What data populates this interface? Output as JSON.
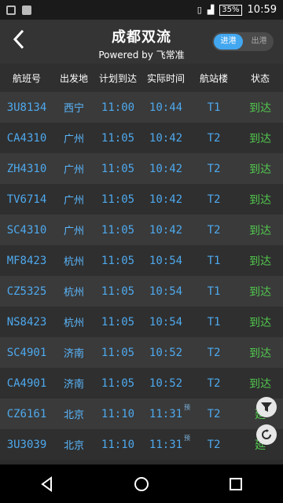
{
  "status_bar": {
    "battery": "35%",
    "time": "10:59",
    "signal_icon": "signal-icon",
    "wifi_icon": "wifi-icon",
    "vibrate_icon": "vibrate-icon"
  },
  "appbar": {
    "title": "成都双流",
    "subtitle": "Powered by 飞常准",
    "tabs": [
      {
        "label": "进港",
        "active": true
      },
      {
        "label": "出港",
        "active": false
      }
    ]
  },
  "table": {
    "headers": [
      "航班号",
      "出发地",
      "计划到达",
      "实际时间",
      "航站楼",
      "状态"
    ],
    "rows": [
      {
        "flight": "3U8134",
        "origin": "西宁",
        "scheduled": "11:00",
        "actual": "10:44",
        "terminal": "T1",
        "status": "到达",
        "mark": ""
      },
      {
        "flight": "CA4310",
        "origin": "广州",
        "scheduled": "11:05",
        "actual": "10:42",
        "terminal": "T2",
        "status": "到达",
        "mark": ""
      },
      {
        "flight": "ZH4310",
        "origin": "广州",
        "scheduled": "11:05",
        "actual": "10:42",
        "terminal": "T2",
        "status": "到达",
        "mark": ""
      },
      {
        "flight": "TV6714",
        "origin": "广州",
        "scheduled": "11:05",
        "actual": "10:42",
        "terminal": "T2",
        "status": "到达",
        "mark": ""
      },
      {
        "flight": "SC4310",
        "origin": "广州",
        "scheduled": "11:05",
        "actual": "10:42",
        "terminal": "T2",
        "status": "到达",
        "mark": ""
      },
      {
        "flight": "MF8423",
        "origin": "杭州",
        "scheduled": "11:05",
        "actual": "10:54",
        "terminal": "T1",
        "status": "到达",
        "mark": ""
      },
      {
        "flight": "CZ5325",
        "origin": "杭州",
        "scheduled": "11:05",
        "actual": "10:54",
        "terminal": "T1",
        "status": "到达",
        "mark": ""
      },
      {
        "flight": "NS8423",
        "origin": "杭州",
        "scheduled": "11:05",
        "actual": "10:54",
        "terminal": "T1",
        "status": "到达",
        "mark": ""
      },
      {
        "flight": "SC4901",
        "origin": "济南",
        "scheduled": "11:05",
        "actual": "10:52",
        "terminal": "T2",
        "status": "到达",
        "mark": ""
      },
      {
        "flight": "CA4901",
        "origin": "济南",
        "scheduled": "11:05",
        "actual": "10:52",
        "terminal": "T2",
        "status": "到达",
        "mark": ""
      },
      {
        "flight": "CZ6161",
        "origin": "北京",
        "scheduled": "11:10",
        "actual": "11:31",
        "terminal": "T2",
        "status": "延",
        "mark": "预"
      },
      {
        "flight": "3U3039",
        "origin": "北京",
        "scheduled": "11:10",
        "actual": "11:31",
        "terminal": "T2",
        "status": "延",
        "mark": "预"
      }
    ]
  },
  "fab": {
    "filter_icon": "filter-icon",
    "refresh_icon": "refresh-icon"
  },
  "navigation": {
    "back_icon": "back-icon",
    "home_icon": "home-icon",
    "recent_icon": "recent-apps-icon"
  }
}
